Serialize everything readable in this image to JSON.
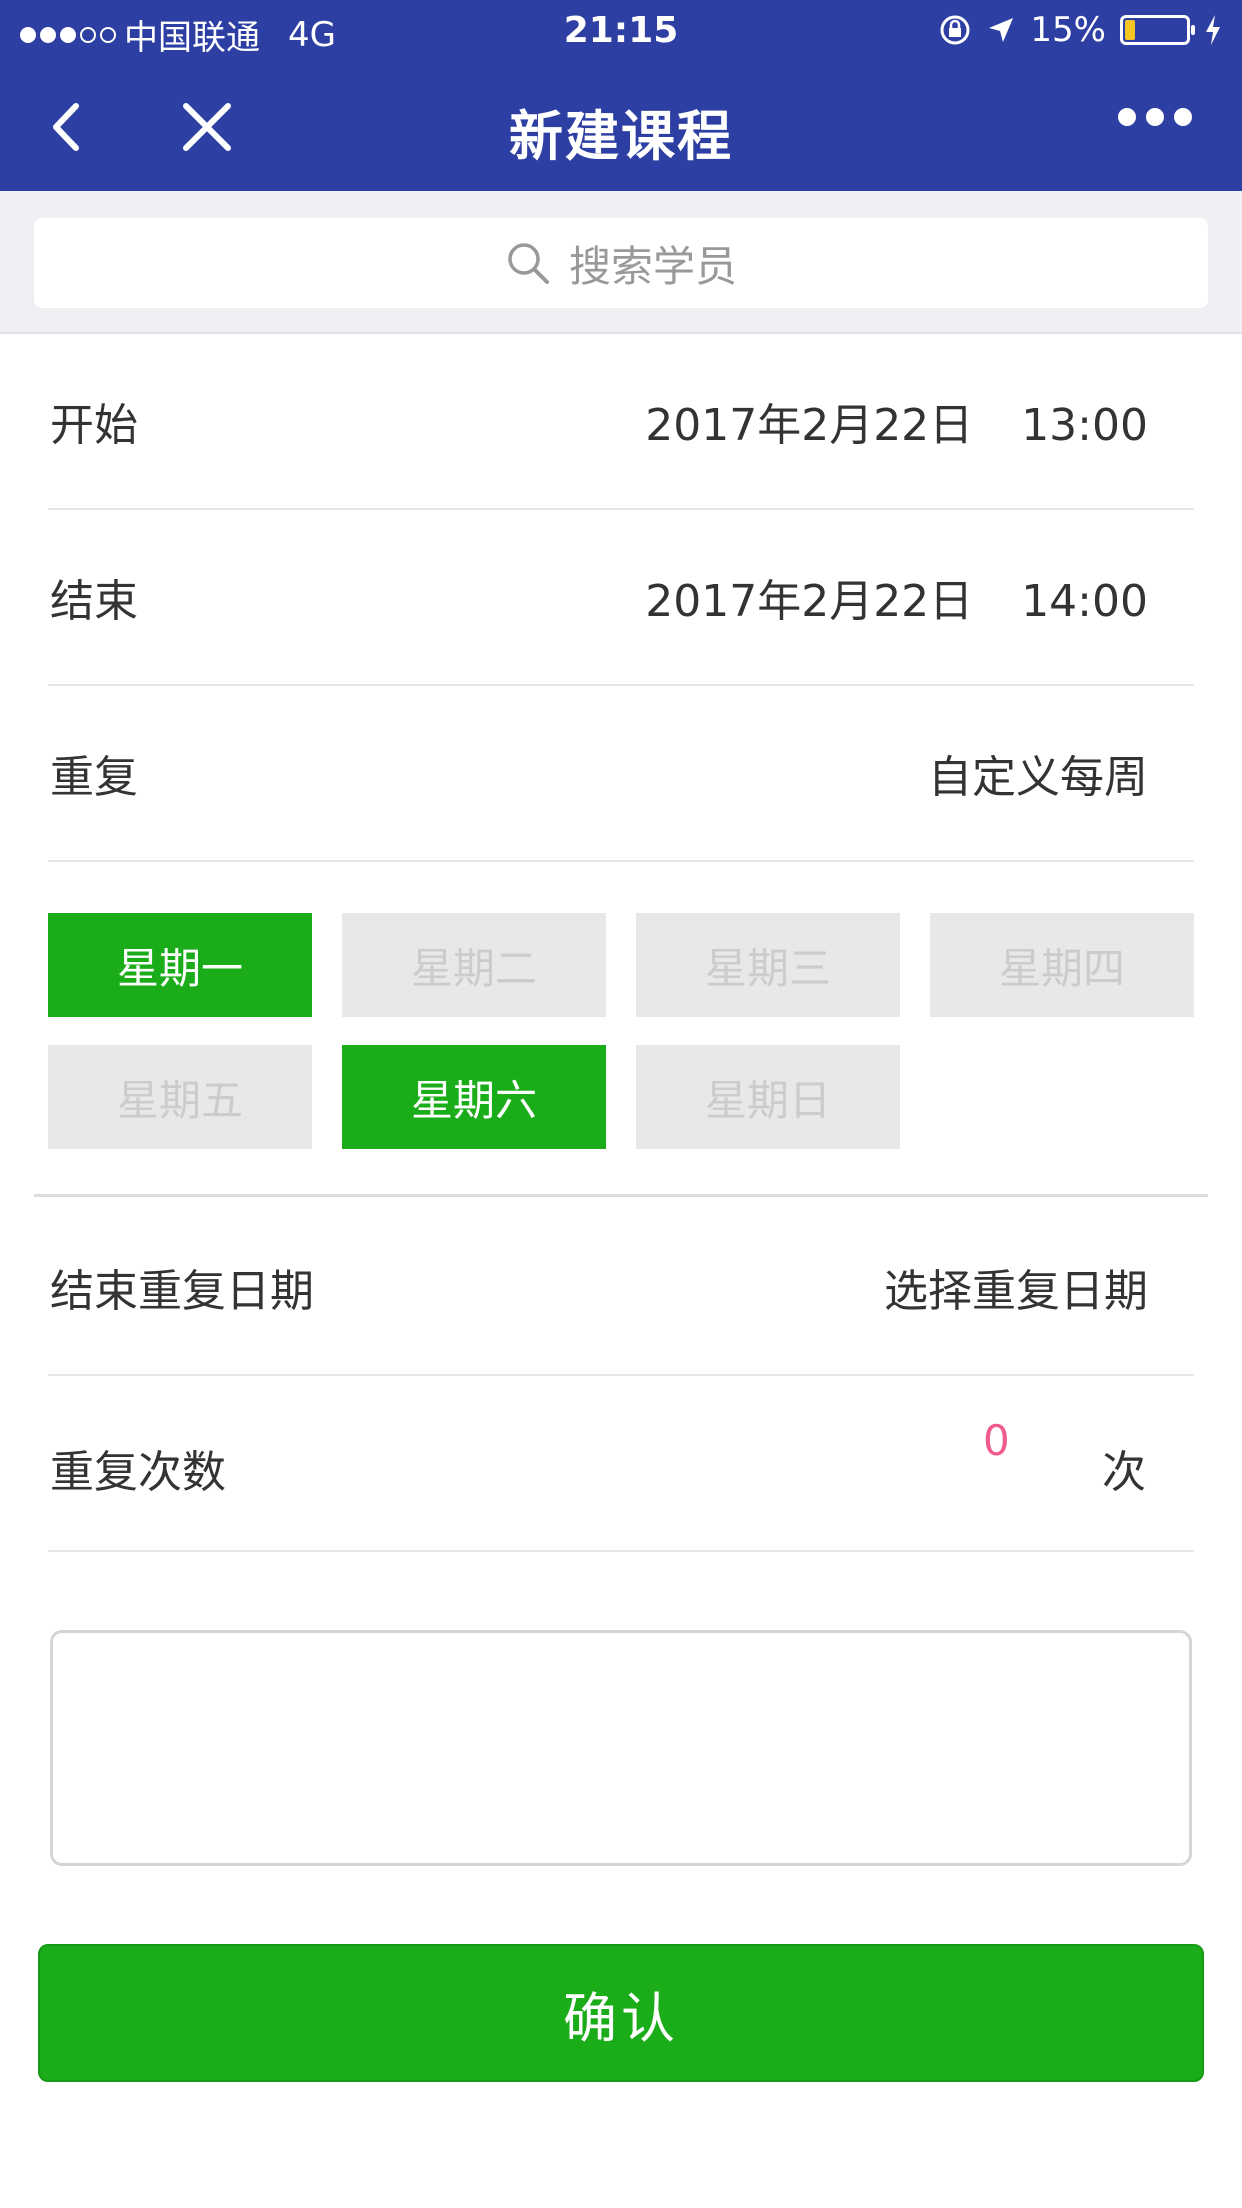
{
  "status_bar": {
    "carrier": "中国联通",
    "network": "4G",
    "time": "21:15",
    "battery": "15%",
    "battery_level": 0.15,
    "signal_bars_filled": 3,
    "signal_bars_total": 5,
    "icons": [
      "orientation-lock-icon",
      "location-arrow-icon",
      "charging-bolt-icon"
    ]
  },
  "nav": {
    "title": "新建课程",
    "icons": [
      "chevron-left-icon",
      "close-icon",
      "more-icon"
    ]
  },
  "search": {
    "placeholder": "搜索学员",
    "icon": "search-icon"
  },
  "form": {
    "start": {
      "label": "开始",
      "date": "2017年2月22日",
      "time": "13:00"
    },
    "end": {
      "label": "结束",
      "date": "2017年2月22日",
      "time": "14:00"
    },
    "repeat": {
      "label": "重复",
      "value": "自定义每周"
    },
    "weekdays": [
      {
        "label": "星期一",
        "selected": true
      },
      {
        "label": "星期二",
        "selected": false
      },
      {
        "label": "星期三",
        "selected": false
      },
      {
        "label": "星期四",
        "selected": false
      },
      {
        "label": "星期五",
        "selected": false
      },
      {
        "label": "星期六",
        "selected": true
      },
      {
        "label": "星期日",
        "selected": false
      }
    ],
    "end_repeat": {
      "label": "结束重复日期",
      "value": "选择重复日期"
    },
    "repeat_count": {
      "label": "重复次数",
      "value": "0",
      "unit": "次"
    },
    "notes": ""
  },
  "confirm_label": "确认",
  "colors": {
    "header": "#2e3fa3",
    "accent_green": "#1aad19",
    "count_pink": "#f05a8c",
    "weekday_off_bg": "#e8e8e8",
    "weekday_off_text": "#cccccc"
  }
}
